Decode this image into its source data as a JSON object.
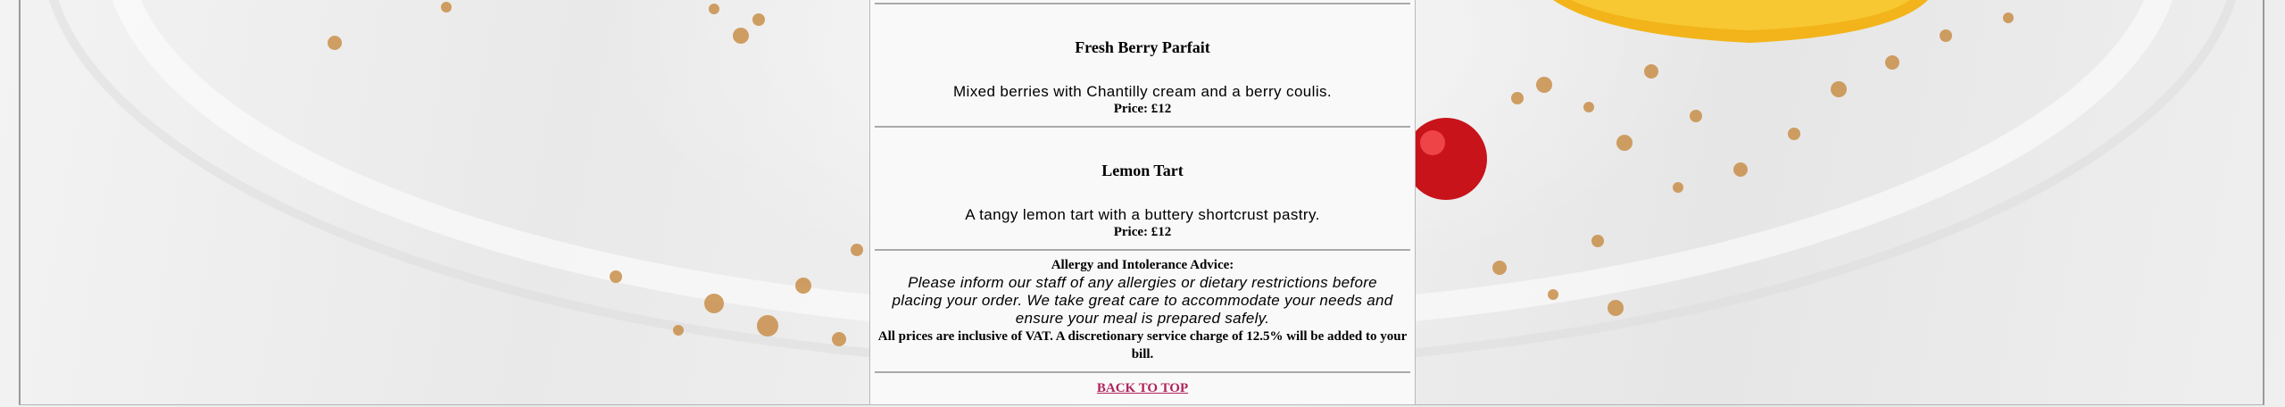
{
  "menu_items": [
    {
      "name": "Fresh Berry Parfait",
      "description": "Mixed berries with Chantilly cream and a berry coulis.",
      "price": "Price: £12"
    },
    {
      "name": "Lemon Tart",
      "description": "A tangy lemon tart with a buttery shortcrust pastry.",
      "price": "Price: £12"
    }
  ],
  "allergy": {
    "title": "Allergy and Intolerance Advice:",
    "text": "Please inform our staff of any allergies or dietary restrictions before placing your order. We take great care to accommodate your needs and ensure your meal is prepared safely.",
    "vat_note": "All prices are inclusive of VAT. A discretionary service charge of 12.5% will be added to your bill."
  },
  "nav": {
    "back_to_top": "BACK TO TOP"
  },
  "colors": {
    "link": "#b0245c",
    "panel_bg": "#f9f9f9",
    "rule": "#a9a9a9"
  }
}
